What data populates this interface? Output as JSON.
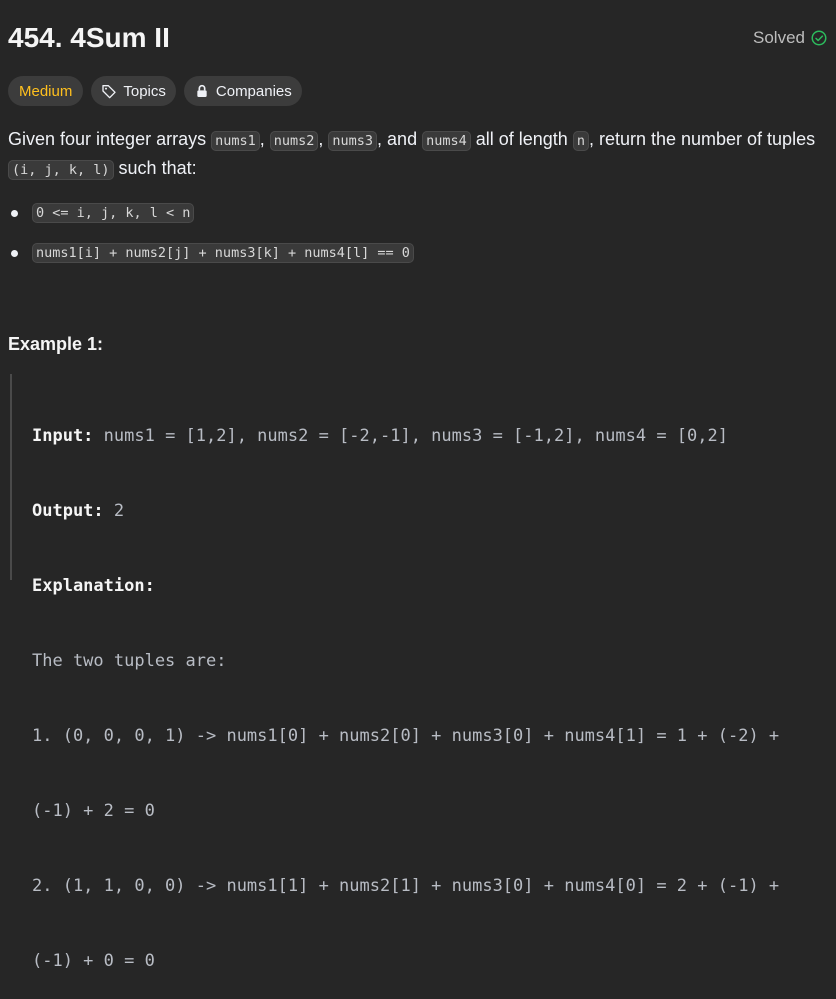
{
  "problem": {
    "title": "454. 4Sum II",
    "status": "Solved"
  },
  "tags": {
    "difficulty": "Medium",
    "topics": "Topics",
    "companies": "Companies"
  },
  "description": {
    "p1": "Given four integer arrays ",
    "c1": "nums1",
    "p2": ", ",
    "c2": "nums2",
    "p3": ", ",
    "c3": "nums3",
    "p4": ", and ",
    "c4": "nums4",
    "p5": " all of length ",
    "c5": "n",
    "p6": ", return the number of tuples ",
    "c6": "(i, j, k, l)",
    "p7": " such that:"
  },
  "constraints": [
    "0 <= i, j, k, l < n",
    "nums1[i] + nums2[j] + nums3[k] + nums4[l] == 0"
  ],
  "example1": {
    "title": "Example 1:",
    "input_label": "Input:",
    "input": " nums1 = [1,2], nums2 = [-2,-1], nums3 = [-1,2], nums4 = [0,2]",
    "output_label": "Output:",
    "output": " 2",
    "explanation_label": "Explanation:",
    "lines": [
      "The two tuples are:",
      "1. (0, 0, 0, 1) -> nums1[0] + nums2[0] + nums3[0] + nums4[1] = 1 + (-2) +",
      "(-1) + 2 = 0",
      "2. (1, 1, 0, 0) -> nums1[1] + nums2[1] + nums3[0] + nums4[0] = 2 + (-1) +",
      "(-1) + 0 = 0"
    ]
  },
  "colors": {
    "background": "#262626",
    "difficulty_medium": "#ffc01e",
    "solved_green": "#2cbb5d"
  }
}
